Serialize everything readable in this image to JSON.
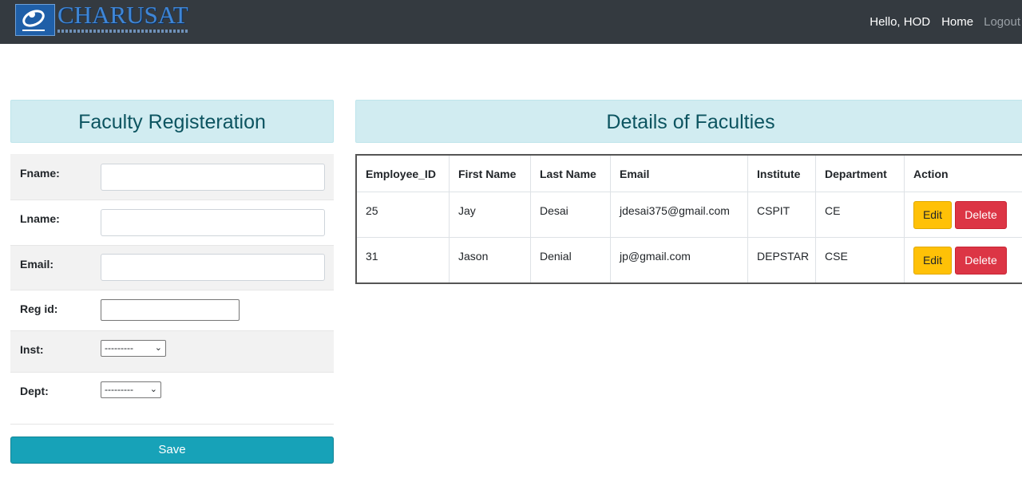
{
  "navbar": {
    "brand": "CHARUSAT",
    "greeting": "Hello, HOD",
    "home": "Home",
    "logout": "Logout"
  },
  "registration": {
    "title": "Faculty Registeration",
    "fields": {
      "fname_label": "Fname:",
      "lname_label": "Lname:",
      "email_label": "Email:",
      "regid_label": "Reg id:",
      "inst_label": "Inst:",
      "dept_label": "Dept:"
    },
    "inst_selected": "---------",
    "dept_selected": "---------",
    "save_label": "Save"
  },
  "details": {
    "title": "Details of Faculties",
    "columns": [
      "Employee_ID",
      "First Name",
      "Last Name",
      "Email",
      "Institute",
      "Department",
      "Action"
    ],
    "rows": [
      {
        "id": "25",
        "first": "Jay",
        "last": "Desai",
        "email": "jdesai375@gmail.com",
        "institute": "CSPIT",
        "department": "CE"
      },
      {
        "id": "31",
        "first": "Jason",
        "last": "Denial",
        "email": "jp@gmail.com",
        "institute": "DEPSTAR",
        "department": "CSE"
      }
    ],
    "edit_label": "Edit",
    "delete_label": "Delete"
  },
  "colors": {
    "navbar": "#343a40",
    "title_box": "#d1ecf1",
    "title_text": "#0c5460",
    "save": "#17a2b8",
    "edit": "#ffc107",
    "delete": "#dc3545"
  }
}
